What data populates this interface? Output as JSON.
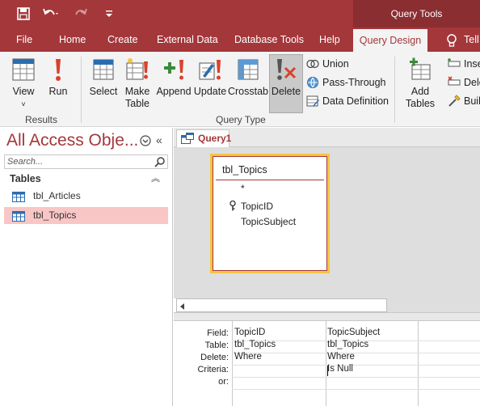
{
  "app": {
    "context_tab": "Query Tools",
    "qat": {
      "undo_icon": "undo-icon",
      "redo_icon": "redo-icon",
      "save_icon": "save-icon",
      "customize_icon": "customize-qat-icon"
    }
  },
  "tabs": [
    {
      "label": "File"
    },
    {
      "label": "Home"
    },
    {
      "label": "Create"
    },
    {
      "label": "External Data"
    },
    {
      "label": "Database Tools"
    },
    {
      "label": "Help"
    },
    {
      "label": "Query Design",
      "active": true
    },
    {
      "label": "Tell",
      "icon": "lightbulb-icon"
    }
  ],
  "ribbon": {
    "results": {
      "group_label": "Results",
      "view_label": "View",
      "run_label": "Run"
    },
    "query_type": {
      "group_label": "Query Type",
      "buttons": [
        {
          "label": "Select",
          "icon": "select-query-icon"
        },
        {
          "label": "Make\nTable",
          "icon": "make-table-icon"
        },
        {
          "label": "Append",
          "icon": "append-query-icon"
        },
        {
          "label": "Update",
          "icon": "update-query-icon"
        },
        {
          "label": "Crosstab",
          "icon": "crosstab-query-icon"
        },
        {
          "label": "Delete",
          "icon": "delete-query-icon",
          "active": true
        }
      ],
      "small": [
        {
          "label": "Union",
          "icon": "union-icon"
        },
        {
          "label": "Pass-Through",
          "icon": "pass-through-icon"
        },
        {
          "label": "Data Definition",
          "icon": "data-definition-icon"
        }
      ]
    },
    "setup": {
      "add_tables_label": "Add\nTables",
      "small": [
        {
          "label": "Inse",
          "icon": "insert-rows-icon"
        },
        {
          "label": "Dele",
          "icon": "delete-rows-icon"
        },
        {
          "label": "Buil",
          "icon": "builder-icon"
        }
      ]
    }
  },
  "nav": {
    "title": "All Access Obje...",
    "search_placeholder": "Search...",
    "section": "Tables",
    "items": [
      {
        "label": "tbl_Articles",
        "selected": false
      },
      {
        "label": "tbl_Topics",
        "selected": true
      }
    ]
  },
  "document": {
    "tab_label": "Query1",
    "table": {
      "name": "tbl_Topics",
      "fields": [
        "*",
        "TopicID",
        "TopicSubject"
      ],
      "primary_key": "TopicID"
    },
    "grid": {
      "row_labels": [
        "Field:",
        "Table:",
        "Delete:",
        "Criteria:",
        "or:"
      ],
      "columns": [
        {
          "field": "TopicID",
          "table": "tbl_Topics",
          "delete": "Where",
          "criteria": "",
          "or": ""
        },
        {
          "field": "TopicSubject",
          "table": "tbl_Topics",
          "delete": "Where",
          "criteria": "Is Null",
          "or": ""
        }
      ]
    }
  },
  "colors": {
    "brand": "#a4373a",
    "selection": "#f9c6c6",
    "highlight_border": "#f4c542"
  }
}
